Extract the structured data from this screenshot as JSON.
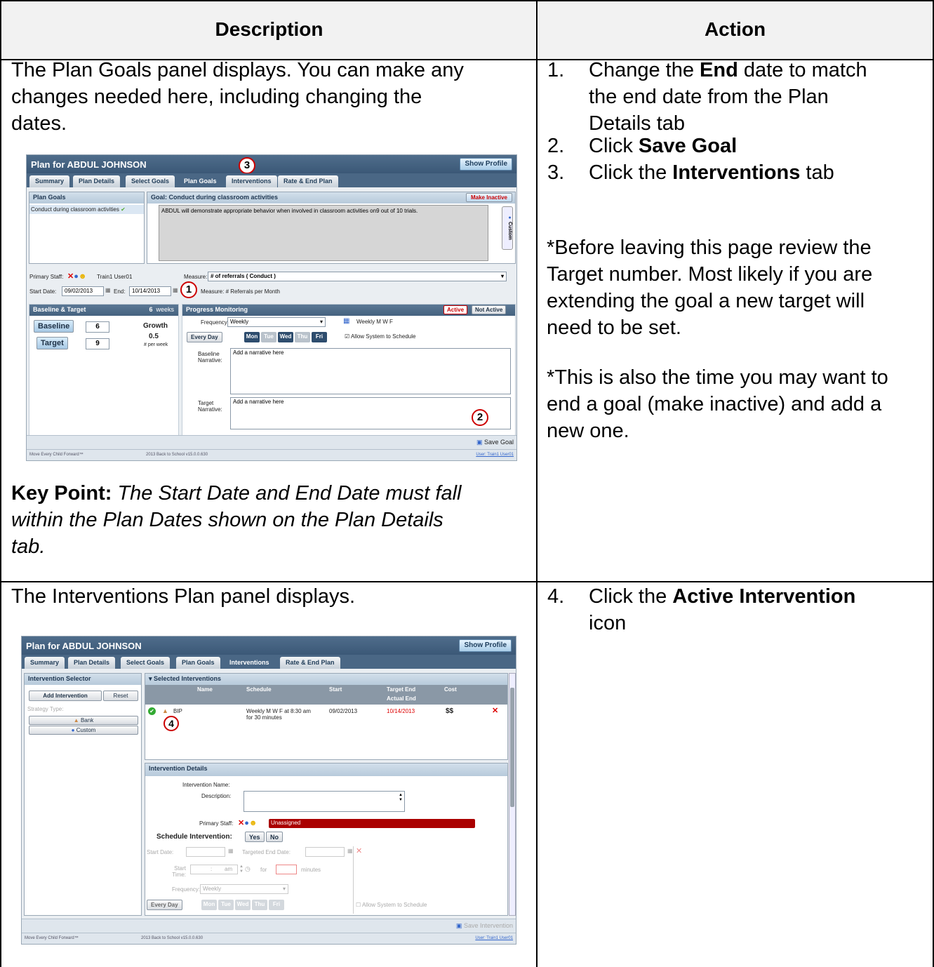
{
  "headers": {
    "description": "Description",
    "action": "Action"
  },
  "row1": {
    "description": "The Plan Goals panel displays. You can make any changes needed here, including changing the dates.",
    "desc_lines": [
      "The Plan Goals panel displays. You can make any",
      "changes needed here, including changing the",
      "dates."
    ],
    "key_point_label": "Key Point:",
    "key_point_lines": [
      " The Start Date and End Date must fall",
      "within the Plan Dates shown on the Plan Details",
      "tab."
    ],
    "steps": [
      {
        "num": "1.",
        "lines": [
          "Change the ",
          "End",
          " date to match",
          "the end date from the Plan",
          "Details tab"
        ]
      },
      {
        "num": "2.",
        "pre": "Click ",
        "bold": "Save Goal",
        "post": ""
      },
      {
        "num": "3.",
        "pre": "Click the ",
        "bold": "Interventions",
        "post": " tab"
      }
    ],
    "note1_lines": [
      "*Before leaving this page review the",
      "Target number. Most likely if you are",
      "extending the goal a new target will",
      "need to be set."
    ],
    "note2_lines": [
      "*This is also the time you may want to",
      "end a goal (make inactive) and add a",
      "new one."
    ],
    "shot": {
      "title": "Plan for ABDUL JOHNSON",
      "show_profile": "Show Profile",
      "tabs": [
        "Summary",
        "Plan Details",
        "Select Goals",
        "Plan Goals",
        "Interventions",
        "Rate & End Plan"
      ],
      "plan_goals_header": "Plan Goals",
      "goal_item": "Conduct during classroom activities",
      "goal_header": "Goal:  Conduct during classroom activities",
      "make_inactive": "Make Inactive",
      "goal_text": "ABDUL will demonstrate appropriate behavior when involved in classroom activities on9 out of 10 trials.",
      "custom": "Custom",
      "primary_staff_label": "Primary Staff:",
      "primary_staff_value": "Train1 User01",
      "measure_label": "Measure:",
      "measure_value": "# of referrals ( Conduct )",
      "start_date_label": "Start Date:",
      "start_date": "09/02/2013",
      "end_label": "End:",
      "end_date": "10/14/2013",
      "measure_note": "Measure:  # Referrals per Month",
      "baseline_target_header": "Baseline & Target",
      "weeks_num": "6",
      "weeks_label": "weeks",
      "baseline_label": "Baseline",
      "baseline_value": "6",
      "target_label": "Target",
      "target_value": "9",
      "growth_label": "Growth",
      "growth_value": "0.5",
      "per_week": "# per week",
      "progress_header": "Progress Monitoring",
      "active": "Active",
      "not_active": "Not Active",
      "frequency_label": "Frequency:",
      "frequency_value": "Weekly",
      "weekly_days": "Weekly M W F",
      "every_day": "Every Day",
      "days": [
        "Mon",
        "Tue",
        "Wed",
        "Thu",
        "Fri"
      ],
      "allow_schedule": "Allow System to Schedule",
      "baseline_narrative_label": "Baseline Narrative:",
      "target_narrative_label": "Target Narrative:",
      "narrative_placeholder": "Add a narrative here",
      "save_goal": "Save Goal",
      "footer_left": "Move Every Child Forward™",
      "footer_mid": "2013 Back to School v15.0.0.630",
      "footer_right": "User: Train1 User01",
      "callouts": [
        "1",
        "2",
        "3"
      ]
    }
  },
  "row2": {
    "description": "The Interventions Plan panel displays.",
    "step": {
      "num": "4.",
      "pre": "Click the ",
      "bold": "Active Intervention",
      "post": "icon"
    },
    "shot": {
      "title": "Plan for ABDUL JOHNSON",
      "show_profile": "Show Profile",
      "tabs": [
        "Summary",
        "Plan Details",
        "Select Goals",
        "Plan Goals",
        "Interventions",
        "Rate & End Plan"
      ],
      "selector_header": "Intervention Selector",
      "add_intervention": "Add Intervention",
      "reset": "Reset",
      "strategy_type": "Strategy Type:",
      "bank": "Bank",
      "custom": "Custom",
      "selected_header": "▾ Selected Interventions",
      "columns": [
        "Name",
        "Schedule",
        "Start",
        "Target End",
        "Actual End",
        "Cost"
      ],
      "row": {
        "name": "BIP",
        "schedule1": "Weekly M W F at 8:30 am",
        "schedule2": "for 30 minutes",
        "start": "09/02/2013",
        "target_end": "10/14/2013",
        "cost": "$$"
      },
      "details_header": "Intervention Details",
      "intervention_name": "Intervention Name:",
      "description": "Description:",
      "primary_staff": "Primary Staff:",
      "unassigned": "Unassigned",
      "schedule_intervention": "Schedule Intervention:",
      "yes": "Yes",
      "no": "No",
      "start_date": "Start Date:",
      "targeted_end": "Targeted End Date:",
      "start_time": "Start Time:",
      "time_sep": ":",
      "am": "am",
      "for": "for",
      "minutes": "minutes",
      "frequency": "Frequency:",
      "weekly": "Weekly",
      "every_day": "Every Day",
      "days": [
        "Mon",
        "Tue",
        "Wed",
        "Thu",
        "Fri"
      ],
      "allow_schedule": "Allow System to Schedule",
      "save_intervention": "Save Intervention",
      "footer_left": "Move Every Child Forward™",
      "footer_mid": "2013 Back to School v15.0.0.630",
      "footer_right": "User: Train1 User01",
      "callout": "4"
    }
  }
}
